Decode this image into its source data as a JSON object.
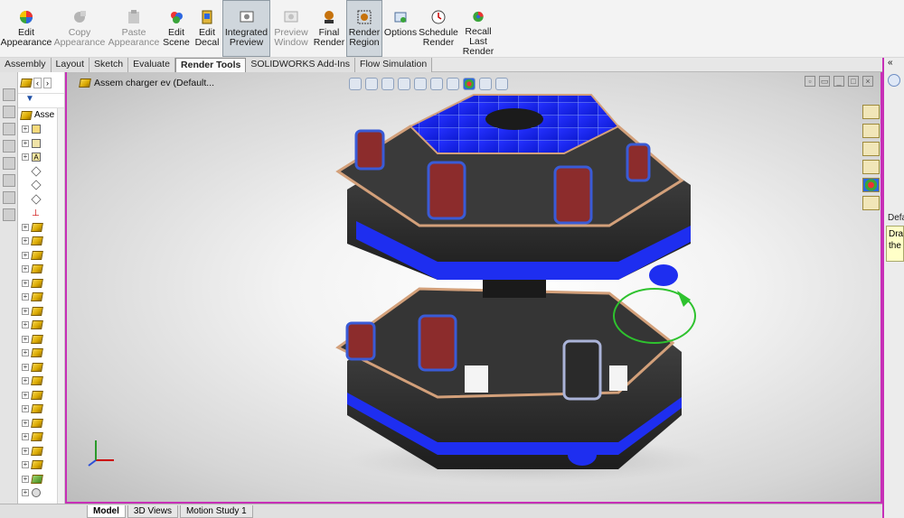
{
  "ribbon": {
    "buttons": [
      {
        "label": "Edit\nAppearance",
        "icon": "appearance-ball-icon",
        "state": "normal"
      },
      {
        "label": "Copy\nAppearance",
        "icon": "copy-appearance-icon",
        "state": "disabled"
      },
      {
        "label": "Paste\nAppearance",
        "icon": "paste-appearance-icon",
        "state": "disabled"
      },
      {
        "label": "Edit\nScene",
        "icon": "scene-icon",
        "state": "normal"
      },
      {
        "label": "Edit\nDecal",
        "icon": "decal-icon",
        "state": "normal"
      },
      {
        "label": "Integrated\nPreview",
        "icon": "integrated-preview-icon",
        "state": "active"
      },
      {
        "label": "Preview\nWindow",
        "icon": "preview-window-icon",
        "state": "disabled"
      },
      {
        "label": "Final\nRender",
        "icon": "final-render-icon",
        "state": "normal"
      },
      {
        "label": "Render\nRegion",
        "icon": "render-region-icon",
        "state": "active"
      },
      {
        "label": "Options",
        "icon": "options-icon",
        "state": "normal"
      },
      {
        "label": "Schedule\nRender",
        "icon": "schedule-render-icon",
        "state": "normal"
      },
      {
        "label": "Recall\nLast\nRender",
        "icon": "recall-render-icon",
        "state": "normal"
      }
    ]
  },
  "tabs": [
    "Assembly",
    "Layout",
    "Sketch",
    "Evaluate",
    "Render Tools",
    "SOLIDWORKS Add-Ins",
    "Flow Simulation"
  ],
  "selected_tab": "Render Tools",
  "tree": {
    "root_label": "Asse",
    "rows_count_visible": 26
  },
  "viewport": {
    "title": "Assem charger ev  (Default..."
  },
  "right_panel": {
    "label": "Defa",
    "tooltip": "Dra the"
  },
  "bottom_tabs": [
    "Model",
    "3D Views",
    "Motion Study 1"
  ],
  "selected_bottom_tab": "Model",
  "colors": {
    "accent_magenta": "#c72fb7",
    "model_blue": "#1e2ef0",
    "model_dark": "#2e2e2e",
    "pad_red": "#8c2c2c"
  }
}
